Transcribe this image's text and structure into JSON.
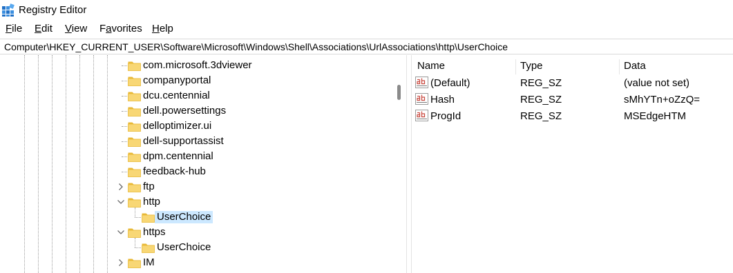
{
  "window": {
    "title": "Registry Editor"
  },
  "menu": {
    "file": {
      "accel": "F",
      "rest": "ile"
    },
    "edit": {
      "accel": "E",
      "rest": "dit"
    },
    "view": {
      "accel": "V",
      "rest": "iew"
    },
    "favorites": {
      "pre": "F",
      "accel": "a",
      "rest": "vorites"
    },
    "help": {
      "accel": "H",
      "rest": "elp"
    }
  },
  "address": {
    "path": "Computer\\HKEY_CURRENT_USER\\Software\\Microsoft\\Windows\\Shell\\Associations\\UrlAssociations\\http\\UserChoice"
  },
  "tree": {
    "items": [
      {
        "label": "com.microsoft.3dviewer",
        "state": "leaf"
      },
      {
        "label": "companyportal",
        "state": "leaf"
      },
      {
        "label": "dcu.centennial",
        "state": "leaf"
      },
      {
        "label": "dell.powersettings",
        "state": "leaf"
      },
      {
        "label": "delloptimizer.ui",
        "state": "leaf"
      },
      {
        "label": "dell-supportassist",
        "state": "leaf"
      },
      {
        "label": "dpm.centennial",
        "state": "leaf"
      },
      {
        "label": "feedback-hub",
        "state": "leaf"
      },
      {
        "label": "ftp",
        "state": "collapsed"
      },
      {
        "label": "http",
        "state": "expanded"
      },
      {
        "label": "UserChoice",
        "state": "selected-child"
      },
      {
        "label": "https",
        "state": "expanded"
      },
      {
        "label": "UserChoice",
        "state": "child"
      },
      {
        "label": "IM",
        "state": "collapsed"
      }
    ]
  },
  "list": {
    "columns": {
      "name": "Name",
      "type": "Type",
      "data": "Data"
    },
    "rows": [
      {
        "name": "(Default)",
        "type": "REG_SZ",
        "data": "(value not set)"
      },
      {
        "name": "Hash",
        "type": "REG_SZ",
        "data": "sMhYTn+oZzQ="
      },
      {
        "name": "ProgId",
        "type": "REG_SZ",
        "data": "MSEdgeHTM"
      }
    ]
  },
  "colors": {
    "selection": "#cce8ff",
    "folder": "#f8d775",
    "folder_dark": "#e8b936",
    "ab_icon": "#c8463c"
  },
  "icons": {
    "app": "registry-editor-icon",
    "folder": "folder-icon",
    "string_value": "string-value-icon"
  }
}
